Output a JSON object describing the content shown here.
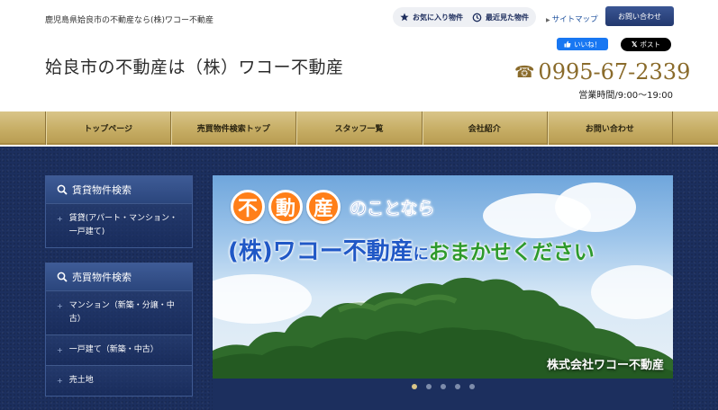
{
  "header": {
    "tagline": "鹿児島県姶良市の不動産なら(株)ワコー不動産",
    "site_title": "姶良市の不動産は（株）ワコー不動産",
    "favorites_label": "お気に入り物件",
    "recent_label": "最近見た物件",
    "sitemap_label": "サイトマップ",
    "contact_label": "お問い合わせ",
    "fb_like_label": "いいね！",
    "x_post_label": "ポスト",
    "phone": "0995-67-2339",
    "hours": "営業時間/9:00〜19:00"
  },
  "nav": {
    "items": [
      {
        "label": "トップページ"
      },
      {
        "label": "売買物件検索トップ"
      },
      {
        "label": "スタッフ一覧"
      },
      {
        "label": "会社紹介"
      },
      {
        "label": "お問い合わせ"
      }
    ]
  },
  "sidebar": {
    "rent": {
      "title": "賃貸物件検索",
      "items": [
        "賃貸(アパート・マンション・一戸建て)"
      ]
    },
    "sale": {
      "title": "売買物件検索",
      "items": [
        "マンション（新築・分譲・中古）",
        "一戸建て（新築・中古）",
        "売土地"
      ]
    }
  },
  "slider": {
    "circle_chars": [
      "不",
      "動",
      "産"
    ],
    "line1_tail": "のことなら",
    "line2_part1": "(株)ワコー不動産",
    "line2_part2": "に",
    "line2_part3": "おまかせください",
    "brand": "株式会社ワコー不動産",
    "dot_count": 5,
    "active_dot": 1
  },
  "colors": {
    "gold": "#8a6b2b",
    "navy": "#1c2f5e",
    "accent_orange": "#ff7f19"
  }
}
